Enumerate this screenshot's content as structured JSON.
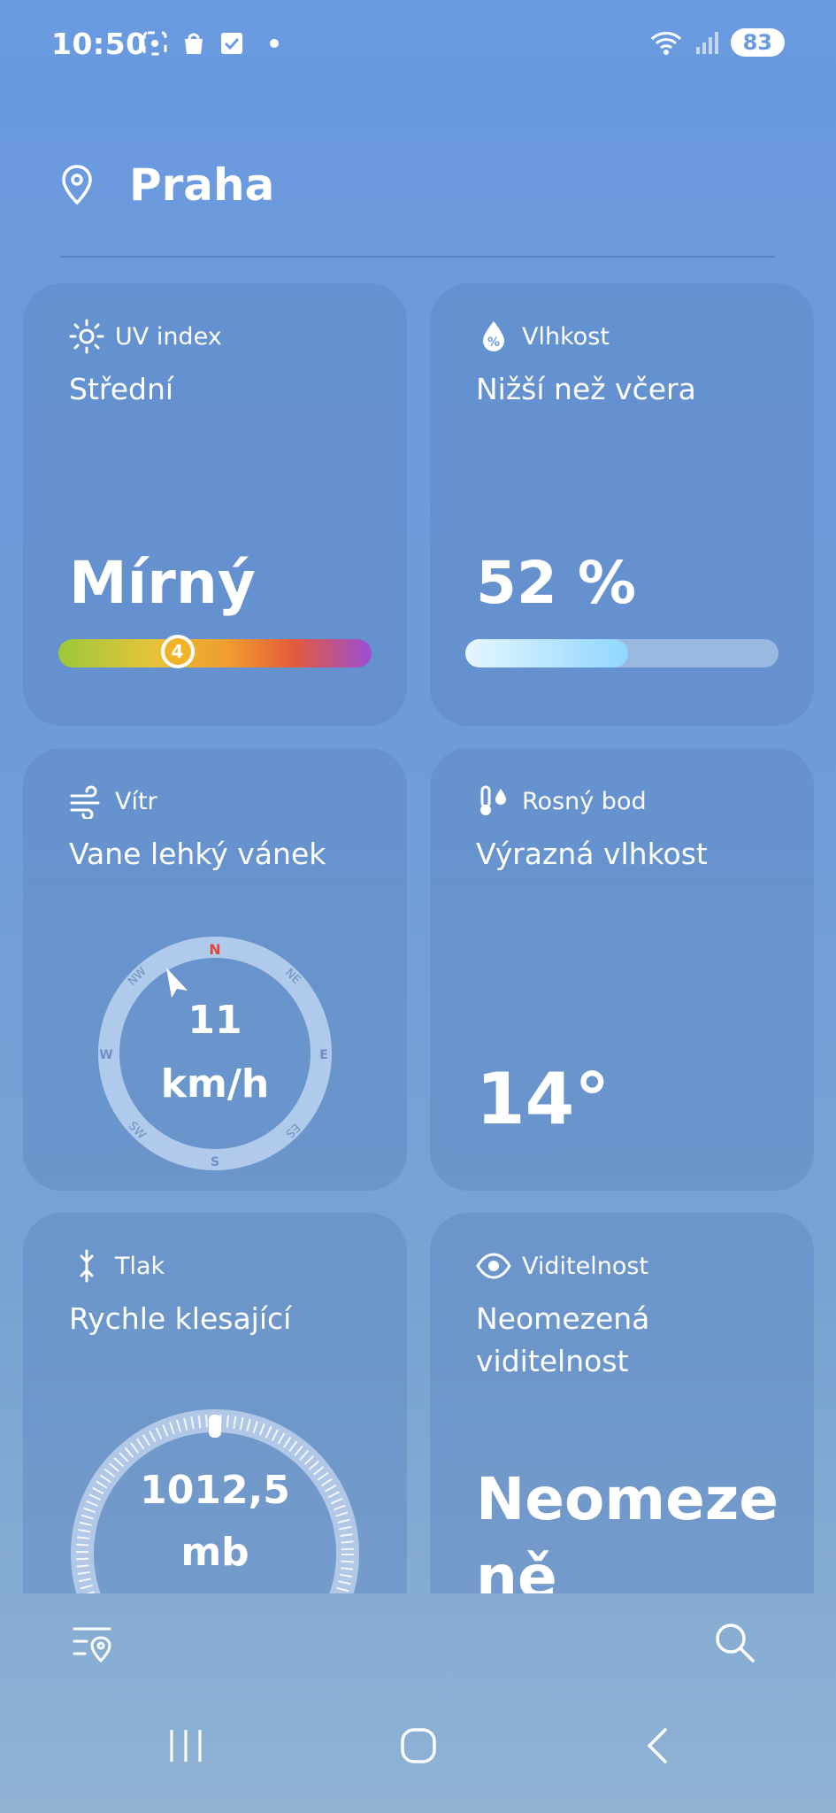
{
  "status_bar": {
    "time": "10:50",
    "battery": "83"
  },
  "location": {
    "city": "Praha"
  },
  "cards": {
    "uv": {
      "label": "UV index",
      "description": "Střední",
      "value": "Mírný",
      "index": "4",
      "index_fraction": 0.38
    },
    "humidity": {
      "label": "Vlhkost",
      "description": "Nižší než včera",
      "value": "52 %",
      "fill_fraction": 0.52
    },
    "wind": {
      "label": "Vítr",
      "description": "Vane lehký vánek",
      "speed": "11",
      "unit": "km/h",
      "compass": {
        "n": "N",
        "ne": "NE",
        "e": "E",
        "es": "ES",
        "s": "S",
        "sw": "SW",
        "w": "W",
        "nw": "NW"
      }
    },
    "dew_point": {
      "label": "Rosný bod",
      "description": "Výrazná vlhkost",
      "value": "14°"
    },
    "pressure": {
      "label": "Tlak",
      "description": "Rychle klesající",
      "value": "1012,5",
      "unit": "mb"
    },
    "visibility": {
      "label": "Viditelnost",
      "description": "Neomezená viditelnost",
      "value_line1": "Neomeze",
      "value_line2": "ně"
    }
  },
  "icons": {
    "location": "location-pin-icon",
    "uv": "sun-icon",
    "humidity": "water-drop-icon",
    "wind": "wind-icon",
    "dew": "thermometer-drops-icon",
    "pressure": "pressure-icon",
    "visibility": "eye-icon",
    "locations": "locations-list-icon",
    "search": "search-icon"
  },
  "colors": {
    "accent": "#6a9adf",
    "uv_knob": "#f0b32a",
    "compass_north": "#e0463c"
  }
}
